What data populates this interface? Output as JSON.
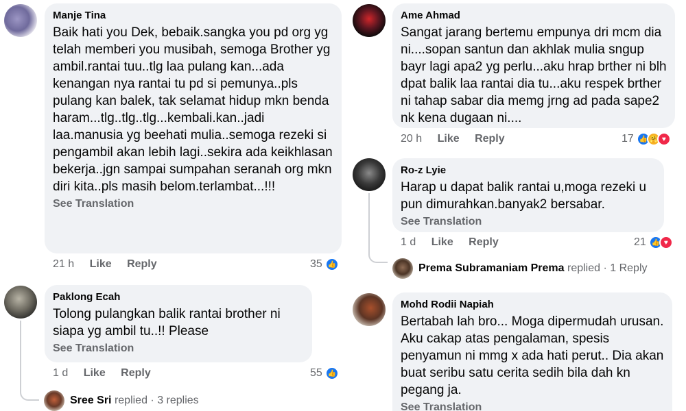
{
  "comments": [
    {
      "name": "Manje Tina",
      "text": "Baik hati you Dek, bebaik.sangka you pd org yg telah memberi you musibah, semoga Brother yg ambil.rantai tuu..tlg laa pulang kan...ada kenangan nya rantai tu pd si pemunya..pls pulang kan balek, tak selamat hidup mkn benda haram...tlg..tlg..tlg...kembali.kan..jadi laa.manusia yg beehati mulia..semoga rezeki si pengambil akan lebih lagi..sekira ada keikhlasan bekerja..jgn sampai sumpahan seranah org mkn diri kita..pls masih belom.terlambat...!!!",
      "see_translation": "See Translation",
      "time": "21 h",
      "like": "Like",
      "reply": "Reply",
      "reaction_count": "35"
    },
    {
      "name": "Paklong Ecah",
      "text": "Tolong pulangkan balik rantai brother ni siapa yg ambil tu..!! Please",
      "see_translation": "See Translation",
      "time": "1 d",
      "like": "Like",
      "reply": "Reply",
      "reaction_count": "55",
      "reply_preview": {
        "name": "Sree Sri",
        "verb": "replied",
        "extra": "· 3 replies"
      }
    },
    {
      "name": "Ame Ahmad",
      "text": "Sangat jarang bertemu empunya dri mcm dia ni....sopan santun dan akhlak mulia sngup bayr lagi apa2 yg perlu...aku hrap brther ni blh dpat balik laa rantai dia tu...aku respek brther ni tahap sabar dia memg jrng ad pada sape2 nk kena dugaan ni....",
      "time": "20 h",
      "like": "Like",
      "reply": "Reply",
      "reaction_count": "17"
    },
    {
      "name": "Ro-z Lyie",
      "text": "Harap u dapat balik rantai u,moga rezeki u pun dimurahkan.banyak2 bersabar.",
      "see_translation": "See Translation",
      "time": "1 d",
      "like": "Like",
      "reply": "Reply",
      "reaction_count": "21",
      "reply_preview": {
        "name": "Prema Subramaniam Prema",
        "verb": "replied",
        "extra": "· 1 Reply"
      }
    },
    {
      "name": "Mohd Rodii Napiah",
      "text": "Bertabah lah bro... Moga dipermudah urusan. Aku cakap atas pengalaman, spesis penyamun ni mmg x ada hati perut.. Dia akan buat seribu satu cerita sedih bila dah kn pegang ja.",
      "see_translation": "See Translation"
    }
  ],
  "reaction_icons": {
    "like": "👍",
    "heart": "♥",
    "care": "🤗"
  },
  "colors": {
    "bubble": "#f0f2f5",
    "meta": "#65676b",
    "like_blue": "#1877f2",
    "heart_red": "#f02849"
  }
}
